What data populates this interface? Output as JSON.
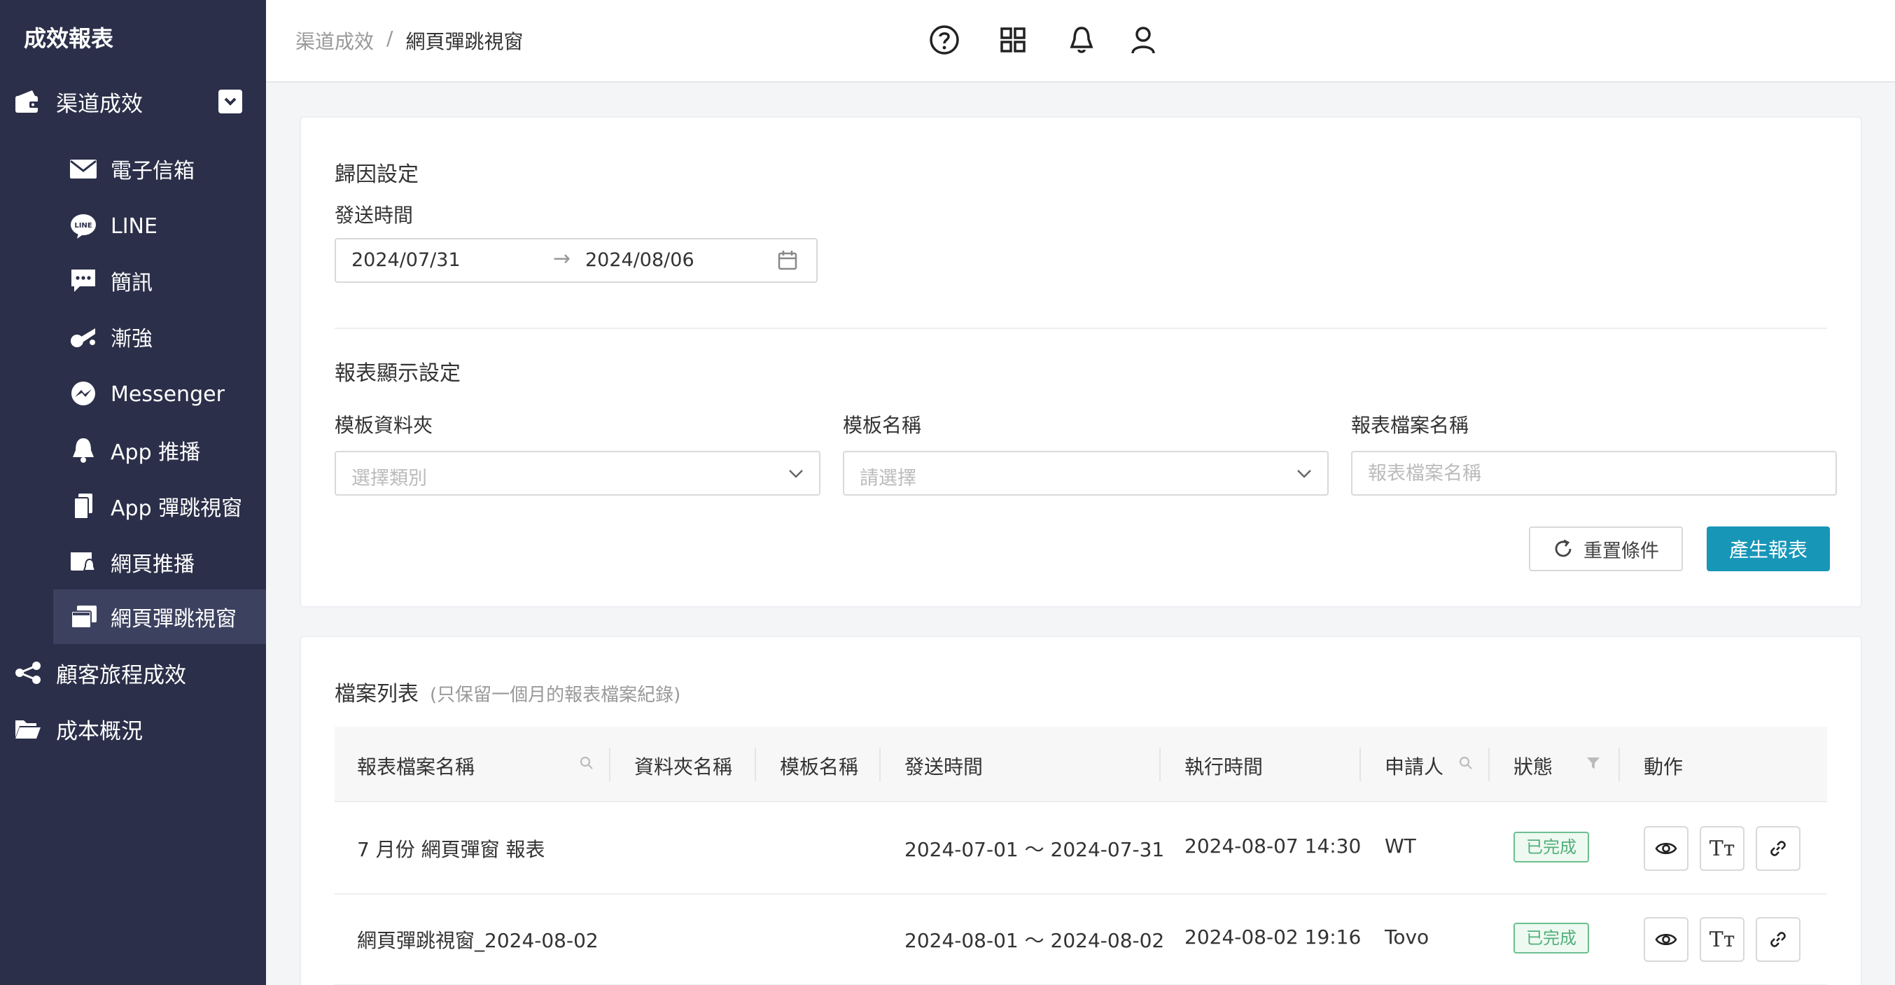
{
  "sidebar": {
    "brand": "成效報表",
    "groups": [
      {
        "label": "渠道成效",
        "icon": "wallet-icon"
      },
      {
        "label": "顧客旅程成效",
        "icon": "journey-icon"
      },
      {
        "label": "成本概況",
        "icon": "folder-open-icon"
      }
    ],
    "items": [
      {
        "label": "電子信箱",
        "icon": "email-icon"
      },
      {
        "label": "LINE",
        "icon": "line-icon"
      },
      {
        "label": "簡訊",
        "icon": "sms-icon"
      },
      {
        "label": "漸強",
        "icon": "crescendo-icon"
      },
      {
        "label": "Messenger",
        "icon": "messenger-icon"
      },
      {
        "label": "App 推播",
        "icon": "bell-icon"
      },
      {
        "label": "App 彈跳視窗",
        "icon": "app-popup-icon"
      },
      {
        "label": "網頁推播",
        "icon": "web-push-icon"
      },
      {
        "label": "網頁彈跳視窗",
        "icon": "web-popup-icon"
      }
    ]
  },
  "header": {
    "breadcrumb_root": "渠道成效",
    "breadcrumb_sep": "/",
    "breadcrumb_current": "網頁彈跳視窗"
  },
  "attribution": {
    "title": "歸因設定",
    "send_time_label": "發送時間",
    "start_date": "2024/07/31",
    "end_date": "2024/08/06"
  },
  "display": {
    "title": "報表顯示設定",
    "folder_label": "模板資料夾",
    "folder_placeholder": "選擇類別",
    "template_label": "模板名稱",
    "template_placeholder": "請選擇",
    "filename_label": "報表檔案名稱",
    "filename_placeholder": "報表檔案名稱",
    "reset_label": "重置條件",
    "generate_label": "產生報表"
  },
  "files": {
    "title": "檔案列表",
    "note": "(只保留一個月的報表檔案紀錄)",
    "columns": [
      "報表檔案名稱",
      "資料夾名稱",
      "模板名稱",
      "發送時間",
      "執行時間",
      "申請人",
      "狀態",
      "動作"
    ],
    "rows": [
      {
        "name": "7 月份 網頁彈窗 報表",
        "folder": "",
        "template": "",
        "send_time": "2024-07-01 ～ 2024-07-31",
        "exec_time": "2024-08-07 14:30",
        "applicant": "WT",
        "status": "已完成"
      },
      {
        "name": "網頁彈跳視窗_2024-08-02",
        "folder": "",
        "template": "",
        "send_time": "2024-08-01 ～ 2024-08-02",
        "exec_time": "2024-08-02 19:16",
        "applicant": "Tovo",
        "status": "已完成"
      }
    ],
    "action_text_label": "Tт"
  },
  "colors": {
    "sidebar_bg": "#2b2f49",
    "primary": "#1796b8",
    "success": "#52b07a"
  }
}
